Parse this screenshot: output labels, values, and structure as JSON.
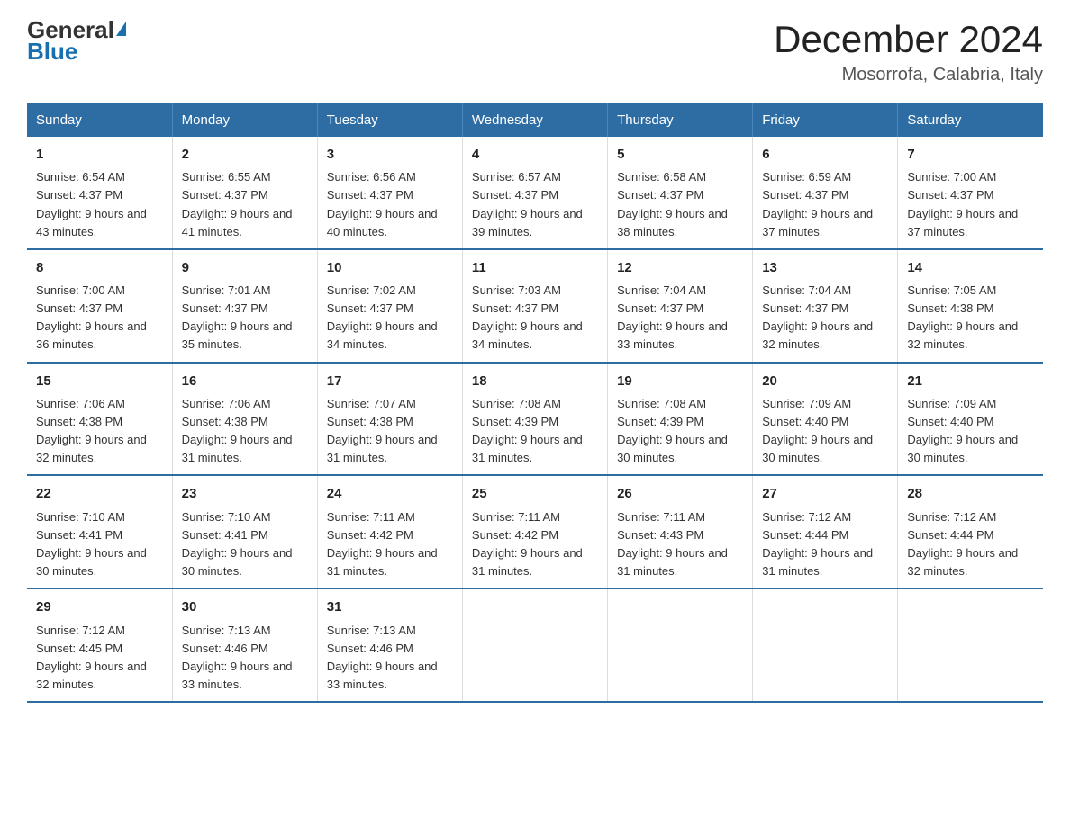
{
  "logo": {
    "line1": "General",
    "arrow": "▶",
    "line2": "Blue"
  },
  "title": "December 2024",
  "subtitle": "Mosorrofa, Calabria, Italy",
  "days_of_week": [
    "Sunday",
    "Monday",
    "Tuesday",
    "Wednesday",
    "Thursday",
    "Friday",
    "Saturday"
  ],
  "weeks": [
    [
      {
        "num": "1",
        "sunrise": "6:54 AM",
        "sunset": "4:37 PM",
        "daylight": "9 hours and 43 minutes."
      },
      {
        "num": "2",
        "sunrise": "6:55 AM",
        "sunset": "4:37 PM",
        "daylight": "9 hours and 41 minutes."
      },
      {
        "num": "3",
        "sunrise": "6:56 AM",
        "sunset": "4:37 PM",
        "daylight": "9 hours and 40 minutes."
      },
      {
        "num": "4",
        "sunrise": "6:57 AM",
        "sunset": "4:37 PM",
        "daylight": "9 hours and 39 minutes."
      },
      {
        "num": "5",
        "sunrise": "6:58 AM",
        "sunset": "4:37 PM",
        "daylight": "9 hours and 38 minutes."
      },
      {
        "num": "6",
        "sunrise": "6:59 AM",
        "sunset": "4:37 PM",
        "daylight": "9 hours and 37 minutes."
      },
      {
        "num": "7",
        "sunrise": "7:00 AM",
        "sunset": "4:37 PM",
        "daylight": "9 hours and 37 minutes."
      }
    ],
    [
      {
        "num": "8",
        "sunrise": "7:00 AM",
        "sunset": "4:37 PM",
        "daylight": "9 hours and 36 minutes."
      },
      {
        "num": "9",
        "sunrise": "7:01 AM",
        "sunset": "4:37 PM",
        "daylight": "9 hours and 35 minutes."
      },
      {
        "num": "10",
        "sunrise": "7:02 AM",
        "sunset": "4:37 PM",
        "daylight": "9 hours and 34 minutes."
      },
      {
        "num": "11",
        "sunrise": "7:03 AM",
        "sunset": "4:37 PM",
        "daylight": "9 hours and 34 minutes."
      },
      {
        "num": "12",
        "sunrise": "7:04 AM",
        "sunset": "4:37 PM",
        "daylight": "9 hours and 33 minutes."
      },
      {
        "num": "13",
        "sunrise": "7:04 AM",
        "sunset": "4:37 PM",
        "daylight": "9 hours and 32 minutes."
      },
      {
        "num": "14",
        "sunrise": "7:05 AM",
        "sunset": "4:38 PM",
        "daylight": "9 hours and 32 minutes."
      }
    ],
    [
      {
        "num": "15",
        "sunrise": "7:06 AM",
        "sunset": "4:38 PM",
        "daylight": "9 hours and 32 minutes."
      },
      {
        "num": "16",
        "sunrise": "7:06 AM",
        "sunset": "4:38 PM",
        "daylight": "9 hours and 31 minutes."
      },
      {
        "num": "17",
        "sunrise": "7:07 AM",
        "sunset": "4:38 PM",
        "daylight": "9 hours and 31 minutes."
      },
      {
        "num": "18",
        "sunrise": "7:08 AM",
        "sunset": "4:39 PM",
        "daylight": "9 hours and 31 minutes."
      },
      {
        "num": "19",
        "sunrise": "7:08 AM",
        "sunset": "4:39 PM",
        "daylight": "9 hours and 30 minutes."
      },
      {
        "num": "20",
        "sunrise": "7:09 AM",
        "sunset": "4:40 PM",
        "daylight": "9 hours and 30 minutes."
      },
      {
        "num": "21",
        "sunrise": "7:09 AM",
        "sunset": "4:40 PM",
        "daylight": "9 hours and 30 minutes."
      }
    ],
    [
      {
        "num": "22",
        "sunrise": "7:10 AM",
        "sunset": "4:41 PM",
        "daylight": "9 hours and 30 minutes."
      },
      {
        "num": "23",
        "sunrise": "7:10 AM",
        "sunset": "4:41 PM",
        "daylight": "9 hours and 30 minutes."
      },
      {
        "num": "24",
        "sunrise": "7:11 AM",
        "sunset": "4:42 PM",
        "daylight": "9 hours and 31 minutes."
      },
      {
        "num": "25",
        "sunrise": "7:11 AM",
        "sunset": "4:42 PM",
        "daylight": "9 hours and 31 minutes."
      },
      {
        "num": "26",
        "sunrise": "7:11 AM",
        "sunset": "4:43 PM",
        "daylight": "9 hours and 31 minutes."
      },
      {
        "num": "27",
        "sunrise": "7:12 AM",
        "sunset": "4:44 PM",
        "daylight": "9 hours and 31 minutes."
      },
      {
        "num": "28",
        "sunrise": "7:12 AM",
        "sunset": "4:44 PM",
        "daylight": "9 hours and 32 minutes."
      }
    ],
    [
      {
        "num": "29",
        "sunrise": "7:12 AM",
        "sunset": "4:45 PM",
        "daylight": "9 hours and 32 minutes."
      },
      {
        "num": "30",
        "sunrise": "7:13 AM",
        "sunset": "4:46 PM",
        "daylight": "9 hours and 33 minutes."
      },
      {
        "num": "31",
        "sunrise": "7:13 AM",
        "sunset": "4:46 PM",
        "daylight": "9 hours and 33 minutes."
      },
      null,
      null,
      null,
      null
    ]
  ]
}
